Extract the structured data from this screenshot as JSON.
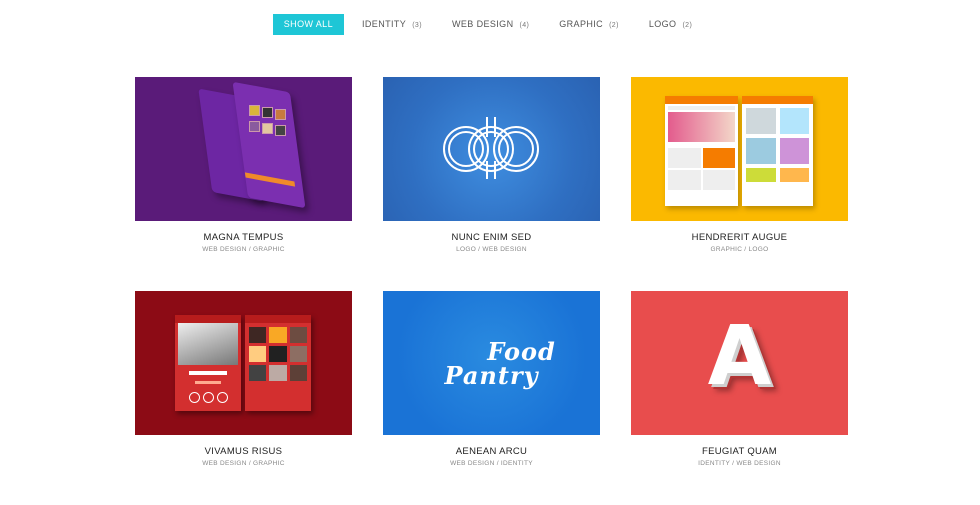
{
  "filters": [
    {
      "label": "SHOW ALL",
      "count": ""
    },
    {
      "label": "IDENTITY",
      "count": "(3)"
    },
    {
      "label": "WEB DESIGN",
      "count": "(4)"
    },
    {
      "label": "GRAPHIC",
      "count": "(2)"
    },
    {
      "label": "LOGO",
      "count": "(2)"
    }
  ],
  "items": [
    {
      "title": "MAGNA TEMPUS",
      "categories": "WEB DESIGN / GRAPHIC"
    },
    {
      "title": "NUNC ENIM SED",
      "categories": "LOGO / WEB DESIGN"
    },
    {
      "title": "HENDRERIT AUGUE",
      "categories": "GRAPHIC / LOGO"
    },
    {
      "title": "VIVAMUS RISUS",
      "categories": "WEB DESIGN / GRAPHIC"
    },
    {
      "title": "AENEAN ARCU",
      "categories": "WEB DESIGN / IDENTITY"
    },
    {
      "title": "FEUGIAT QUAM",
      "categories": "IDENTITY / WEB DESIGN"
    }
  ],
  "thumbs": {
    "food_line1": "Food",
    "food_line2": "Pantry",
    "letter": "A"
  },
  "colors": {
    "accent": "#1ec6d6",
    "purple": "#5a1b79",
    "blue": "#2f6fc2",
    "yellow": "#fbb900",
    "crimson": "#8c0b15",
    "food_blue": "#1a73d6",
    "coral": "#e84d4d"
  }
}
